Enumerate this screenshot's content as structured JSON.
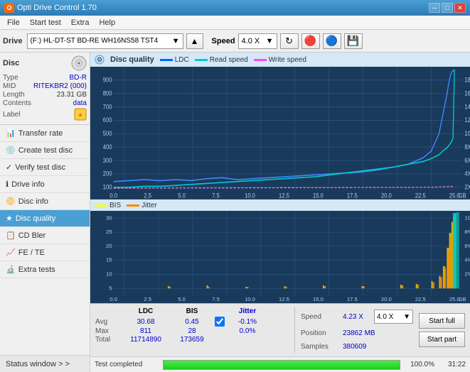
{
  "titlebar": {
    "title": "Opti Drive Control 1.70",
    "minimize": "─",
    "maximize": "□",
    "close": "✕"
  },
  "menu": {
    "items": [
      "File",
      "Start test",
      "Extra",
      "Help"
    ]
  },
  "toolbar": {
    "drive_label": "Drive",
    "drive_value": "(F:)  HL-DT-ST BD-RE  WH16NS58 TST4",
    "eject_icon": "▲",
    "speed_label": "Speed",
    "speed_value": "4.0 X",
    "refresh_icon": "↻",
    "icon1": "🔴",
    "icon2": "🔵",
    "icon3": "💾"
  },
  "disc_panel": {
    "title": "Disc",
    "type_label": "Type",
    "type_value": "BD-R",
    "mid_label": "MID",
    "mid_value": "RITEKBR2 (000)",
    "length_label": "Length",
    "length_value": "23.31 GB",
    "contents_label": "Contents",
    "contents_value": "data",
    "label_label": "Label",
    "label_value": ""
  },
  "nav": {
    "items": [
      {
        "id": "transfer-rate",
        "label": "Transfer rate",
        "icon": "📊"
      },
      {
        "id": "create-test-disc",
        "label": "Create test disc",
        "icon": "💿"
      },
      {
        "id": "verify-test-disc",
        "label": "Verify test disc",
        "icon": "✓"
      },
      {
        "id": "drive-info",
        "label": "Drive info",
        "icon": "ℹ"
      },
      {
        "id": "disc-info",
        "label": "Disc info",
        "icon": "📀"
      },
      {
        "id": "disc-quality",
        "label": "Disc quality",
        "icon": "★",
        "active": true
      },
      {
        "id": "cd-bler",
        "label": "CD Bler",
        "icon": "📋"
      },
      {
        "id": "fe-te",
        "label": "FE / TE",
        "icon": "📈"
      },
      {
        "id": "extra-tests",
        "label": "Extra tests",
        "icon": "🔬"
      }
    ],
    "status_window": "Status window > >"
  },
  "chart": {
    "title": "Disc quality",
    "legend": {
      "ldc_label": "LDC",
      "read_label": "Read speed",
      "write_label": "Write speed",
      "bis_label": "BIS",
      "jitter_label": "Jitter"
    },
    "top": {
      "y_max": 900,
      "y_labels": [
        "900",
        "800",
        "700",
        "600",
        "500",
        "400",
        "300",
        "200",
        "100"
      ],
      "x_labels": [
        "0.0",
        "2.5",
        "5.0",
        "7.5",
        "10.0",
        "12.5",
        "15.0",
        "17.5",
        "20.0",
        "22.5",
        "25.0"
      ],
      "y_right": [
        "18X",
        "16X",
        "14X",
        "12X",
        "10X",
        "8X",
        "6X",
        "4X",
        "2X"
      ]
    },
    "bottom": {
      "y_labels": [
        "30",
        "25",
        "20",
        "15",
        "10",
        "5"
      ],
      "x_labels": [
        "0.0",
        "2.5",
        "5.0",
        "7.5",
        "10.0",
        "12.5",
        "15.0",
        "17.5",
        "20.0",
        "22.5",
        "25.0"
      ],
      "y_right": [
        "10%",
        "8%",
        "6%",
        "4%",
        "2%"
      ]
    }
  },
  "stats": {
    "headers": [
      "LDC",
      "BIS",
      "",
      "Jitter",
      "Speed",
      ""
    ],
    "avg_label": "Avg",
    "max_label": "Max",
    "total_label": "Total",
    "ldc_avg": "30.68",
    "ldc_max": "811",
    "ldc_total": "11714890",
    "bis_avg": "0.45",
    "bis_max": "28",
    "bis_total": "173659",
    "jitter_avg": "-0.1%",
    "jitter_max": "0.0%",
    "jitter_total": "",
    "speed_label": "Speed",
    "speed_value": "4.23 X",
    "speed_select": "4.0 X",
    "position_label": "Position",
    "position_value": "23862 MB",
    "samples_label": "Samples",
    "samples_value": "380609",
    "start_full_label": "Start full",
    "start_part_label": "Start part"
  },
  "progress": {
    "status_text": "Test completed",
    "progress_pct": 100,
    "progress_display": "100.0%",
    "time_display": "31:22"
  },
  "colors": {
    "accent_blue": "#4a9fd4",
    "chart_bg": "#1a3a5c",
    "ldc_color": "#0066ff",
    "read_color": "#00cccc",
    "write_color": "#ff44ff",
    "bis_color": "#ffff00",
    "jitter_color": "#ff8800",
    "grid_color": "#2a5a8c"
  }
}
